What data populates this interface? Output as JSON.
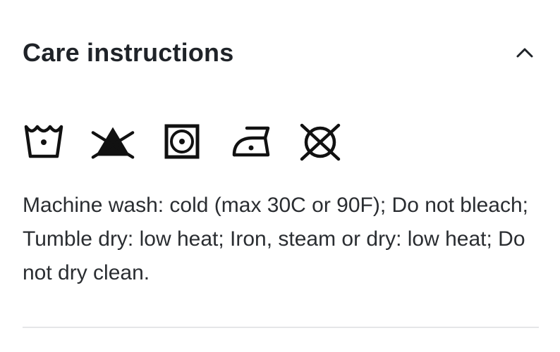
{
  "care": {
    "title": "Care instructions",
    "expanded": true,
    "toggle_icon": "chevron-up-icon",
    "icons": [
      {
        "name": "machine-wash-cold-icon"
      },
      {
        "name": "do-not-bleach-icon"
      },
      {
        "name": "tumble-dry-low-icon"
      },
      {
        "name": "iron-low-icon"
      },
      {
        "name": "do-not-dry-clean-icon"
      }
    ],
    "description": "Machine wash: cold (max 30C or 90F); Do not bleach; Tumble dry: low heat; Iron, steam or dry: low heat; Do not dry clean."
  },
  "colors": {
    "text": "#1f2328",
    "divider": "#e5e6e8",
    "background": "#ffffff"
  }
}
